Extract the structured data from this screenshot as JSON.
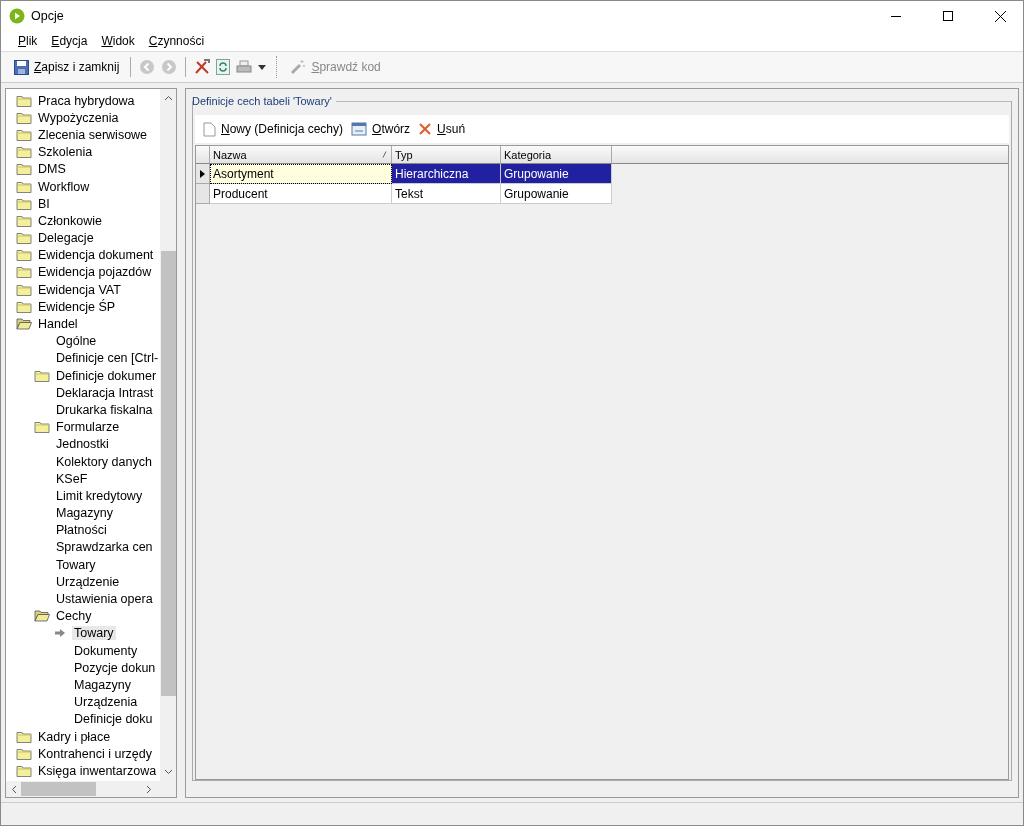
{
  "window": {
    "title": "Opcje"
  },
  "menu": [
    "Plik",
    "Edycja",
    "Widok",
    "Czynności"
  ],
  "toolbar": {
    "save_label": "Zapisz i zamknij",
    "check_label": "Sprawdź kod",
    "check_disabled": true
  },
  "tree": [
    {
      "label": "Praca hybrydowa",
      "kind": "folder",
      "expanded": false
    },
    {
      "label": "Wypożyczenia",
      "kind": "folder",
      "expanded": false
    },
    {
      "label": "Zlecenia serwisowe",
      "kind": "folder",
      "expanded": false
    },
    {
      "label": "Szkolenia",
      "kind": "folder",
      "expanded": false
    },
    {
      "label": "DMS",
      "kind": "folder",
      "expanded": false
    },
    {
      "label": "Workflow",
      "kind": "folder",
      "expanded": false
    },
    {
      "label": "BI",
      "kind": "folder",
      "expanded": false
    },
    {
      "label": "Członkowie",
      "kind": "folder",
      "expanded": false
    },
    {
      "label": "Delegacje",
      "kind": "folder",
      "expanded": false
    },
    {
      "label": "Ewidencja dokument",
      "kind": "folder",
      "expanded": false
    },
    {
      "label": "Ewidencja pojazdów",
      "kind": "folder",
      "expanded": false
    },
    {
      "label": "Ewidencja VAT",
      "kind": "folder",
      "expanded": false
    },
    {
      "label": "Ewidencje ŚP",
      "kind": "folder",
      "expanded": false
    },
    {
      "label": "Handel",
      "kind": "folder",
      "expanded": true,
      "children": [
        {
          "label": "Ogólne",
          "kind": "leaf",
          "selected": false
        },
        {
          "label": "Definicje cen [Ctrl-",
          "kind": "leaf",
          "selected": false
        },
        {
          "label": "Definicje dokumer",
          "kind": "folder",
          "expanded": false
        },
        {
          "label": "Deklaracja Intrast",
          "kind": "leaf",
          "selected": false
        },
        {
          "label": "Drukarka fiskalna",
          "kind": "leaf",
          "selected": false
        },
        {
          "label": "Formularze",
          "kind": "folder",
          "expanded": false
        },
        {
          "label": "Jednostki",
          "kind": "leaf",
          "selected": false
        },
        {
          "label": "Kolektory danych",
          "kind": "leaf",
          "selected": false
        },
        {
          "label": "KSeF",
          "kind": "leaf",
          "selected": false
        },
        {
          "label": "Limit kredytowy",
          "kind": "leaf",
          "selected": false
        },
        {
          "label": "Magazyny",
          "kind": "leaf",
          "selected": false
        },
        {
          "label": "Płatności",
          "kind": "leaf",
          "selected": false
        },
        {
          "label": "Sprawdzarka cen",
          "kind": "leaf",
          "selected": false
        },
        {
          "label": "Towary",
          "kind": "leaf",
          "selected": false
        },
        {
          "label": "Urządzenie",
          "kind": "leaf",
          "selected": false
        },
        {
          "label": "Ustawienia opera",
          "kind": "leaf",
          "selected": false
        },
        {
          "label": "Cechy",
          "kind": "folder",
          "expanded": true,
          "children": [
            {
              "label": "Towary",
              "kind": "leaf",
              "selected": true
            },
            {
              "label": "Dokumenty",
              "kind": "leaf",
              "selected": false
            },
            {
              "label": "Pozycje dokun",
              "kind": "leaf",
              "selected": false
            },
            {
              "label": "Magazyny",
              "kind": "leaf",
              "selected": false
            },
            {
              "label": "Urządzenia",
              "kind": "leaf",
              "selected": false
            },
            {
              "label": "Definicje doku",
              "kind": "leaf",
              "selected": false
            }
          ]
        }
      ]
    },
    {
      "label": "Kadry i płace",
      "kind": "folder",
      "expanded": false
    },
    {
      "label": "Kontrahenci i urzędy",
      "kind": "folder",
      "expanded": false
    },
    {
      "label": "Księga inwentarzowa",
      "kind": "folder",
      "expanded": false
    }
  ],
  "group": {
    "title": "Definicje cech tabeli 'Towary'"
  },
  "actions": [
    {
      "kind": "new",
      "label": "Nowy (Definicja cechy)"
    },
    {
      "kind": "open",
      "label": "Otwórz"
    },
    {
      "kind": "delete",
      "label": "Usuń"
    }
  ],
  "grid": {
    "columns": [
      "Nazwa",
      "Typ",
      "Kategoria"
    ],
    "rows": [
      {
        "cells": [
          "Asortyment",
          "Hierarchiczna",
          "Grupowanie"
        ],
        "selected": true,
        "current": true
      },
      {
        "cells": [
          "Producent",
          "Tekst",
          "Grupowanie"
        ],
        "selected": false,
        "current": false
      }
    ]
  }
}
